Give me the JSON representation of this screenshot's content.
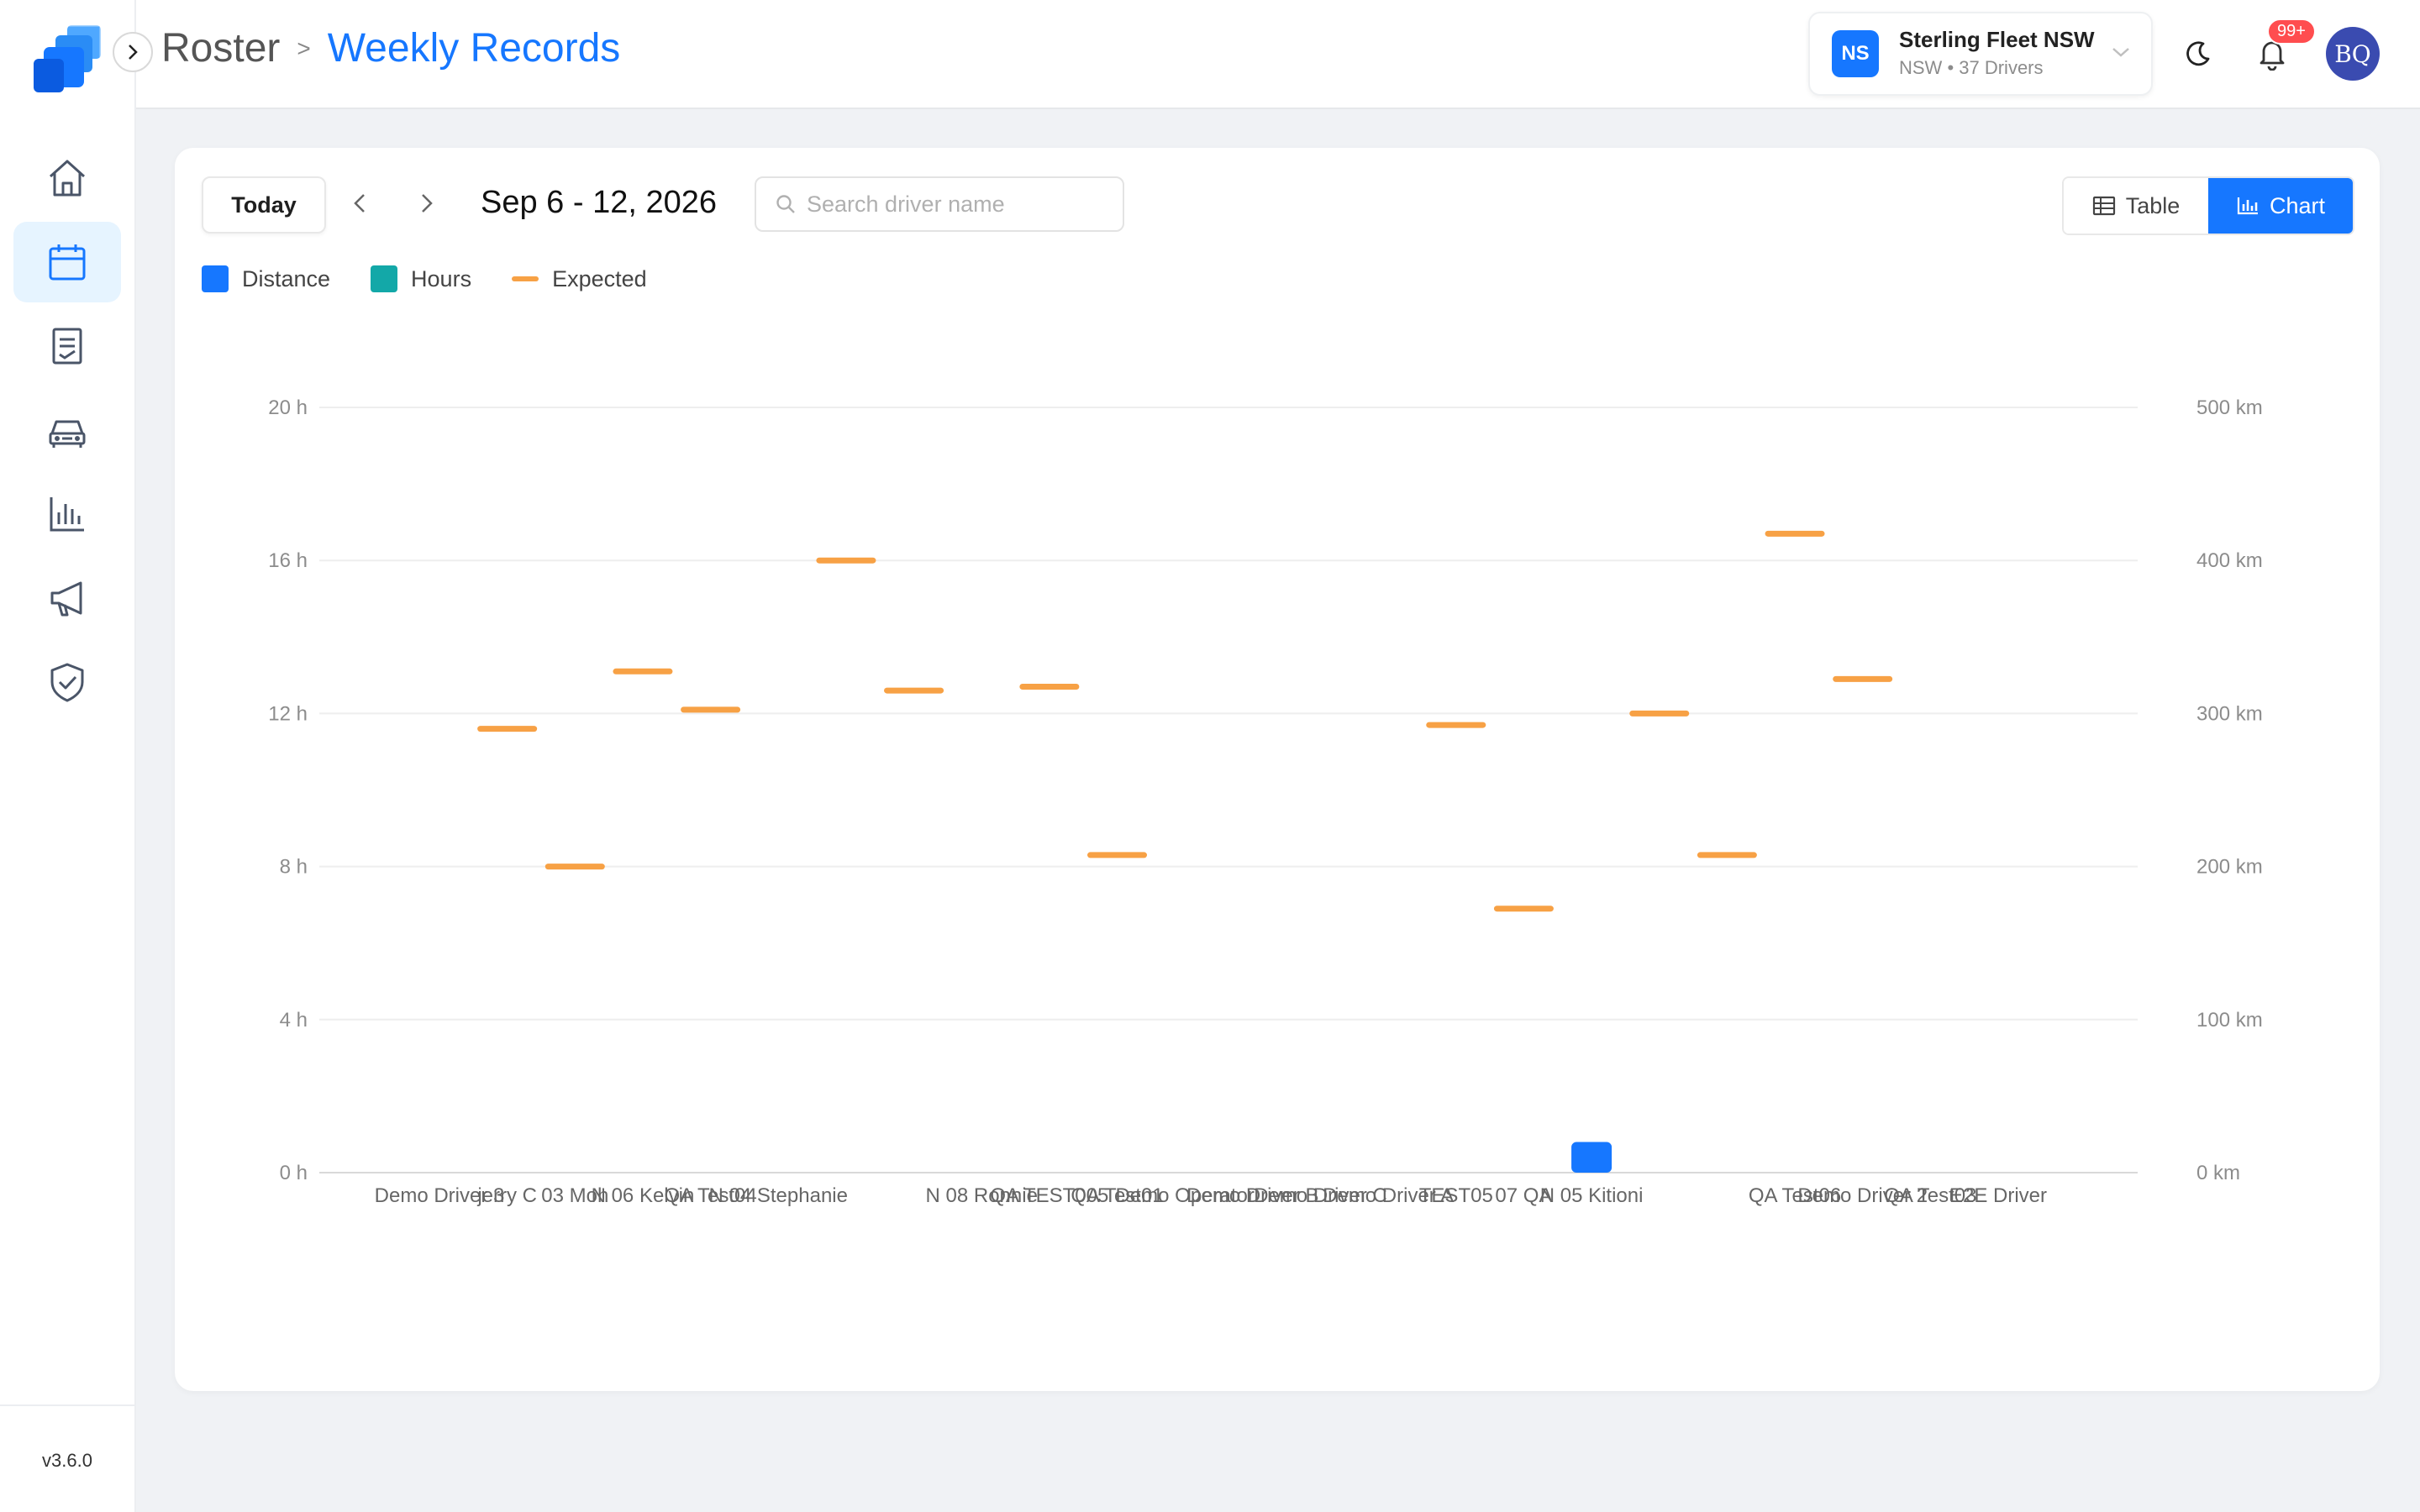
{
  "app": {
    "version": "v3.6.0",
    "nav": [
      {
        "icon": "home-icon",
        "active": false
      },
      {
        "icon": "calendar-icon",
        "active": true
      },
      {
        "icon": "records-icon",
        "active": false
      },
      {
        "icon": "vehicle-icon",
        "active": false
      },
      {
        "icon": "bar-chart-icon",
        "active": false
      },
      {
        "icon": "megaphone-icon",
        "active": false
      },
      {
        "icon": "shield-check-icon",
        "active": false
      }
    ]
  },
  "header": {
    "breadcrumb_root": "Roster",
    "breadcrumb_sep": ">",
    "breadcrumb_current": "Weekly Records",
    "org": {
      "initials": "NS",
      "name": "Sterling Fleet NSW",
      "subtitle": "NSW • 37 Drivers"
    },
    "notifications_badge": "99+",
    "user_initials": "BQ"
  },
  "toolbar": {
    "today_label": "Today",
    "date_range": "Sep 6 - 12, 2026",
    "search_placeholder": "Search driver name",
    "view_table_label": "Table",
    "view_chart_label": "Chart",
    "active_view": "Chart"
  },
  "legend": {
    "distance": "Distance",
    "hours": "Hours",
    "expected": "Expected"
  },
  "colors": {
    "accent": "#1677ff",
    "distance": "#1677ff",
    "hours": "#13a8a8",
    "expected": "#f7a145",
    "badge": "#ff4d4f"
  },
  "chart_data": {
    "type": "bar",
    "y_left": {
      "unit": "h",
      "ylim": [
        0,
        20
      ],
      "ticks": [
        "0 h",
        "4 h",
        "8 h",
        "12 h",
        "16 h",
        "20 h"
      ]
    },
    "y_right": {
      "unit": "km",
      "ylim": [
        0,
        500
      ],
      "ticks": [
        "0 km",
        "100 km",
        "200 km",
        "300 km",
        "400 km",
        "500 km"
      ]
    },
    "grid": true,
    "legend_position": "top-left",
    "categories": [
      "Demo Driver 3",
      "jerry C",
      "03 Moh",
      "N 06 Kelvin",
      "QA Test04",
      "N 04 Stephanie",
      "",
      "",
      "N 08 Ronnie",
      "QA TEST005",
      "QA Test01",
      "Demo Operator",
      "Demo Driver B",
      "Demo Driver C",
      "Demo Driver A",
      "TEST05",
      "07 QA",
      "N 05 Kitioni",
      "",
      "",
      "QA Test06",
      "Demo Driver 2",
      "QA Test03",
      "E2E Driver"
    ],
    "series": [
      {
        "name": "Distance",
        "unit": "km",
        "values": [
          0,
          0,
          0,
          0,
          0,
          0,
          0,
          0,
          0,
          0,
          0,
          0,
          0,
          0,
          0,
          0,
          0,
          20,
          0,
          0,
          0,
          0,
          0,
          0
        ]
      },
      {
        "name": "Hours",
        "unit": "h",
        "values": [
          0,
          0,
          0,
          0,
          0,
          0,
          0,
          0,
          0,
          0,
          0,
          0,
          0,
          0,
          0,
          0,
          0,
          0,
          0,
          0,
          0,
          0,
          0,
          0
        ]
      },
      {
        "name": "Expected",
        "unit": "h",
        "values": [
          null,
          11.6,
          8.0,
          13.1,
          12.1,
          null,
          16.0,
          12.6,
          null,
          12.7,
          8.3,
          null,
          null,
          null,
          null,
          11.7,
          6.9,
          null,
          12.0,
          8.3,
          16.7,
          12.9,
          null,
          null
        ]
      }
    ]
  }
}
